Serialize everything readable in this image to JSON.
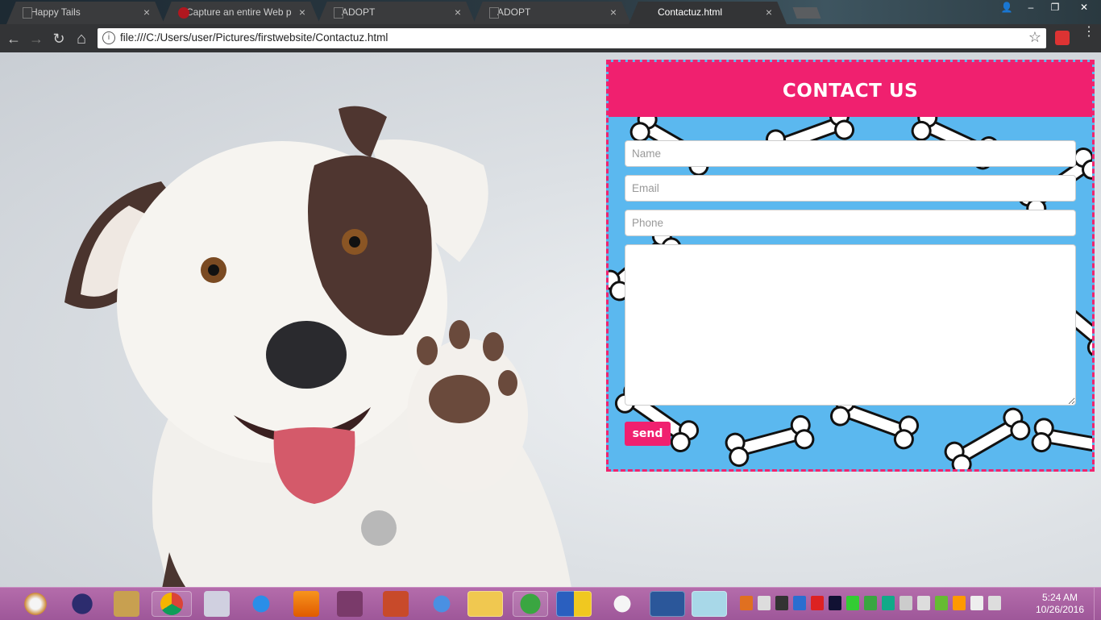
{
  "browser": {
    "tabs": [
      {
        "title": "Happy Tails",
        "active": false
      },
      {
        "title": "Capture an entire Web p",
        "active": false
      },
      {
        "title": "ADOPT",
        "active": false
      },
      {
        "title": "ADOPT",
        "active": false
      },
      {
        "title": "Contactuz.html",
        "active": true
      }
    ],
    "close_glyph": "×",
    "url": "file:///C:/Users/user/Pictures/firstwebsite/Contactuz.html",
    "info_glyph": "i",
    "star_glyph": "☆",
    "back_glyph": "←",
    "forward_glyph": "→",
    "reload_glyph": "↻",
    "home_glyph": "⌂",
    "menu_glyph": "⋮",
    "window_controls": {
      "user": "👤",
      "minimize": "–",
      "restore": "❐",
      "close": "✕"
    }
  },
  "contact": {
    "title": "CONTACT US",
    "name_placeholder": "Name",
    "email_placeholder": "Email",
    "phone_placeholder": "Phone",
    "message_value": "",
    "send_label": "send",
    "accent_color": "#f0206f",
    "background_color": "#5bb8ef"
  },
  "taskbar": {
    "apps": [
      "snipping-tool-icon",
      "eclipse-icon",
      "dosbox-icon",
      "chrome-icon",
      "cmd-icon",
      "internet-explorer-icon",
      "vlc-icon",
      "winrar-icon",
      "adobe-flash-icon",
      "chrome-canary-icon",
      "file-explorer-icon",
      "utorrent-icon",
      "security-shield-icon",
      "itunes-icon",
      "word-icon",
      "notepad-icon"
    ],
    "time": "5:24 AM",
    "date": "10/26/2016"
  }
}
